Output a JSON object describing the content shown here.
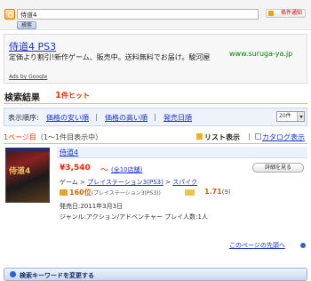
{
  "search": {
    "value": "侍道4",
    "submit_label": "検索",
    "alert_label": "條件通知"
  },
  "ad": {
    "title": "侍道4 PS3",
    "url": "www.suruga-ya.jp",
    "description": "定価より割引!新作ゲーム、販売中。送料無料でお届け。駿河屋",
    "credit": "Ads by Google"
  },
  "results": {
    "title": "検索結果",
    "hit_count": "1",
    "hit_suffix": "件ヒット"
  },
  "sort": {
    "label": "表示順序:",
    "options": [
      "価格の安い順",
      "価格の高い順",
      "発売日順"
    ],
    "separator": "|",
    "per_page": "20件"
  },
  "page": {
    "number": "1ページ目",
    "range": "（1～1件目表示中）",
    "list_view": "リスト表示",
    "separator": "|",
    "catalog_view": "カタログ表示"
  },
  "product": {
    "image_text": "侍道4",
    "title": "侍道4",
    "price": "¥3,540",
    "price_tilde": "～",
    "store_count": "(全10店舗)",
    "detail_label": "詳細を見る",
    "category_parts": [
      "ゲーム",
      "プレイステーション3(PS3)",
      "スパイク"
    ],
    "category_sep": ">",
    "points": "160位",
    "points_note": "(プレイステーション3(PS3))",
    "rating": "1.71",
    "rating_count": "(9)",
    "release_date": "発売日:2011年3月3日",
    "genre": "ジャンル:アクション/アドベンチャー プレイ人数:1人"
  },
  "footer": {
    "top_link": "このページの先頭へ",
    "change_keyword": "検索キーワードを変更する"
  },
  "colors": {
    "price": "#ff2200",
    "link": "#1a33cc",
    "accent_orange": "#ff3300",
    "ad_url": "#008000"
  }
}
